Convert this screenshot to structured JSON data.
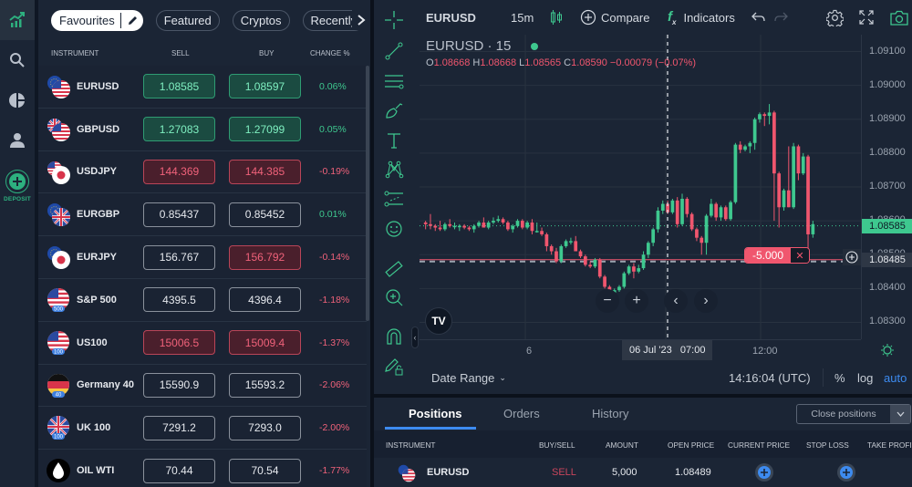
{
  "leftnav": {
    "items": [
      {
        "name": "markets",
        "icon": "chart-trend-icon",
        "active": true
      },
      {
        "name": "search",
        "icon": "search-icon"
      },
      {
        "name": "portfolio",
        "icon": "pie-chart-icon"
      },
      {
        "name": "account",
        "icon": "user-icon"
      }
    ],
    "deposit_label": "DEPOSIT"
  },
  "watchlist": {
    "tabs": [
      {
        "label": "Favourites",
        "active": true
      },
      {
        "label": "Featured"
      },
      {
        "label": "Cryptos"
      },
      {
        "label": "Recently"
      }
    ],
    "columns": {
      "instrument": "INSTRUMENT",
      "sell": "SELL",
      "buy": "BUY",
      "change": "CHANGE %"
    },
    "rows": [
      {
        "name": "EURUSD",
        "sell": "1.08585",
        "buy": "1.08597",
        "change": "0.06%",
        "sell_state": "up",
        "buy_state": "up",
        "dir": "pos",
        "flag": "eu-us"
      },
      {
        "name": "GBPUSD",
        "sell": "1.27083",
        "buy": "1.27099",
        "change": "0.05%",
        "sell_state": "up",
        "buy_state": "up",
        "dir": "pos",
        "flag": "gb-us"
      },
      {
        "name": "USDJPY",
        "sell": "144.369",
        "buy": "144.385",
        "change": "-0.19%",
        "sell_state": "down",
        "buy_state": "down",
        "dir": "neg",
        "flag": "us-jp"
      },
      {
        "name": "EURGBP",
        "sell": "0.85437",
        "buy": "0.85452",
        "change": "0.01%",
        "sell_state": "flat",
        "buy_state": "flat",
        "dir": "pos",
        "flag": "eu-gb"
      },
      {
        "name": "EURJPY",
        "sell": "156.767",
        "buy": "156.792",
        "change": "-0.14%",
        "sell_state": "flat",
        "buy_state": "down",
        "dir": "neg",
        "flag": "eu-jp"
      },
      {
        "name": "S&P 500",
        "sell": "4395.5",
        "buy": "4396.4",
        "change": "-1.18%",
        "sell_state": "flat",
        "buy_state": "flat",
        "dir": "neg",
        "flag": "us-500",
        "badge": "500"
      },
      {
        "name": "US100",
        "sell": "15006.5",
        "buy": "15009.4",
        "change": "-1.37%",
        "sell_state": "down",
        "buy_state": "down",
        "dir": "neg",
        "flag": "us-100",
        "badge": "100"
      },
      {
        "name": "Germany 40",
        "sell": "15590.9",
        "buy": "15593.2",
        "change": "-2.06%",
        "sell_state": "flat",
        "buy_state": "flat",
        "dir": "neg",
        "flag": "de-40",
        "badge": "40"
      },
      {
        "name": "UK 100",
        "sell": "7291.2",
        "buy": "7293.0",
        "change": "-2.00%",
        "sell_state": "flat",
        "buy_state": "flat",
        "dir": "neg",
        "flag": "gb-100",
        "badge": "100"
      },
      {
        "name": "OIL WTI",
        "sell": "70.44",
        "buy": "70.54",
        "change": "-1.77%",
        "sell_state": "flat",
        "buy_state": "flat",
        "dir": "neg",
        "flag": "oil"
      }
    ]
  },
  "chart": {
    "symbol": "EURUSD",
    "interval": "15m",
    "compare_label": "Compare",
    "indicators_label": "Indicators",
    "legend_title": "EURUSD · 15",
    "ohlc": {
      "o_label": "O",
      "o": "1.08668",
      "h_label": "H",
      "h": "1.08668",
      "l_label": "L",
      "l": "1.08565",
      "c_label": "C",
      "c": "1.08590",
      "change": "−0.00079 (−0.07%)"
    },
    "y_labels": [
      "1.09100",
      "1.09000",
      "1.08900",
      "1.08800",
      "1.08700",
      "1.08600",
      "1.08500",
      "1.08400",
      "1.08300"
    ],
    "current_price": "1.08585",
    "position_price": "1.08485",
    "position_label": "-5.000",
    "x_labels": [
      "6",
      "12:00"
    ],
    "crosshair_time": "06 Jul '23   07:00",
    "date_range_label": "Date Range",
    "clock": "14:16:04 (UTC)",
    "scale_opts": {
      "pct": "%",
      "log": "log",
      "auto": "auto"
    },
    "colors": {
      "up": "#3ec88f",
      "down": "#f0566e",
      "bg": "#1b2535"
    }
  },
  "chart_data": {
    "type": "candlestick",
    "title": "EURUSD · 15",
    "ylim": [
      1.0825,
      1.0915
    ],
    "candles": [
      [
        1.08595,
        1.086,
        1.08575,
        1.0859
      ],
      [
        1.0859,
        1.0862,
        1.08575,
        1.08585
      ],
      [
        1.08585,
        1.0859,
        1.0857,
        1.0858
      ],
      [
        1.0858,
        1.086,
        1.0857,
        1.08575
      ],
      [
        1.08575,
        1.08595,
        1.0857,
        1.0859
      ],
      [
        1.0859,
        1.08605,
        1.0858,
        1.08585
      ],
      [
        1.08585,
        1.08595,
        1.08575,
        1.08585
      ],
      [
        1.08585,
        1.0859,
        1.0857,
        1.08585
      ],
      [
        1.08585,
        1.0859,
        1.08575,
        1.0858
      ],
      [
        1.0858,
        1.08585,
        1.0857,
        1.08575
      ],
      [
        1.08575,
        1.0859,
        1.08565,
        1.08585
      ],
      [
        1.08585,
        1.086,
        1.0858,
        1.08595
      ],
      [
        1.08595,
        1.0861,
        1.08585,
        1.0858
      ],
      [
        1.0858,
        1.086,
        1.08575,
        1.08595
      ],
      [
        1.08595,
        1.0861,
        1.0859,
        1.086
      ],
      [
        1.086,
        1.08615,
        1.08595,
        1.08605
      ],
      [
        1.08605,
        1.0861,
        1.0859,
        1.08595
      ],
      [
        1.08595,
        1.086,
        1.0857,
        1.08575
      ],
      [
        1.08575,
        1.0859,
        1.08565,
        1.08585
      ],
      [
        1.08585,
        1.08605,
        1.0858,
        1.086
      ],
      [
        1.086,
        1.08605,
        1.08575,
        1.0858
      ],
      [
        1.0858,
        1.086,
        1.08575,
        1.08595
      ],
      [
        1.08595,
        1.08605,
        1.0856,
        1.0857
      ],
      [
        1.0857,
        1.08595,
        1.08565,
        1.0857
      ],
      [
        1.0857,
        1.0858,
        1.08555,
        1.0856
      ],
      [
        1.0856,
        1.08565,
        1.0851,
        1.08525
      ],
      [
        1.08525,
        1.0853,
        1.085,
        1.0851
      ],
      [
        1.0851,
        1.0852,
        1.08475,
        1.0848
      ],
      [
        1.0848,
        1.0853,
        1.08475,
        1.08525
      ],
      [
        1.08525,
        1.08545,
        1.0852,
        1.0854
      ],
      [
        1.0854,
        1.0855,
        1.0853,
        1.0854
      ],
      [
        1.0854,
        1.08555,
        1.0851,
        1.0851
      ],
      [
        1.0851,
        1.08515,
        1.0849,
        1.08495
      ],
      [
        1.08495,
        1.085,
        1.08465,
        1.0847
      ],
      [
        1.0847,
        1.0848,
        1.0846,
        1.08465
      ],
      [
        1.08465,
        1.0849,
        1.0846,
        1.08485
      ],
      [
        1.08485,
        1.0849,
        1.0843,
        1.08435
      ],
      [
        1.08435,
        1.0844,
        1.084,
        1.08405
      ],
      [
        1.08405,
        1.0841,
        1.0838,
        1.08385
      ],
      [
        1.08385,
        1.084,
        1.0837,
        1.08395
      ],
      [
        1.08395,
        1.0841,
        1.0839,
        1.08405
      ],
      [
        1.08405,
        1.0845,
        1.084,
        1.08445
      ],
      [
        1.08445,
        1.0847,
        1.0844,
        1.08465
      ],
      [
        1.08465,
        1.08475,
        1.0843,
        1.0845
      ],
      [
        1.0845,
        1.0847,
        1.08445,
        1.0846
      ],
      [
        1.0846,
        1.0851,
        1.08455,
        1.085
      ],
      [
        1.085,
        1.0854,
        1.0849,
        1.08535
      ],
      [
        1.08535,
        1.0858,
        1.08525,
        1.08575
      ],
      [
        1.08575,
        1.0864,
        1.08565,
        1.0863
      ],
      [
        1.0863,
        1.0866,
        1.0862,
        1.0865
      ],
      [
        1.0865,
        1.0866,
        1.0862,
        1.08625
      ],
      [
        1.08625,
        1.08665,
        1.0862,
        1.0866
      ],
      [
        1.0866,
        1.0867,
        1.0858,
        1.0859
      ],
      [
        1.0859,
        1.0868,
        1.08585,
        1.08665
      ],
      [
        1.08665,
        1.0867,
        1.0861,
        1.0862
      ],
      [
        1.0862,
        1.08625,
        1.0857,
        1.08575
      ],
      [
        1.08575,
        1.0858,
        1.0854,
        1.0855
      ],
      [
        1.0855,
        1.08555,
        1.085,
        1.08535
      ],
      [
        1.08535,
        1.0862,
        1.085,
        1.08615
      ],
      [
        1.08615,
        1.08665,
        1.0861,
        1.0865
      ],
      [
        1.0865,
        1.08655,
        1.086,
        1.0861
      ],
      [
        1.0861,
        1.08645,
        1.086,
        1.0864
      ],
      [
        1.0864,
        1.08645,
        1.086,
        1.08605
      ],
      [
        1.08605,
        1.0866,
        1.086,
        1.08655
      ],
      [
        1.08655,
        1.0883,
        1.0865,
        1.08825
      ],
      [
        1.08825,
        1.08835,
        1.088,
        1.0881
      ],
      [
        1.0881,
        1.08825,
        1.08805,
        1.0882
      ],
      [
        1.0882,
        1.08835,
        1.088,
        1.0883
      ],
      [
        1.0883,
        1.08905,
        1.0881,
        1.089
      ],
      [
        1.089,
        1.0892,
        1.0889,
        1.08915
      ],
      [
        1.08915,
        1.0892,
        1.0888,
        1.0891
      ],
      [
        1.0891,
        1.08945,
        1.08885,
        1.0892
      ],
      [
        1.0892,
        1.08925,
        1.086,
        1.0874
      ],
      [
        1.0874,
        1.08745,
        1.0858,
        1.0864
      ],
      [
        1.0864,
        1.08695,
        1.0863,
        1.0869
      ],
      [
        1.0869,
        1.0882,
        1.0864,
        1.0864
      ],
      [
        1.0864,
        1.0883,
        1.08635,
        1.0882
      ],
      [
        1.0882,
        1.08825,
        1.0872,
        1.0874
      ],
      [
        1.0874,
        1.088,
        1.08735,
        1.0879
      ],
      [
        1.0879,
        1.08795,
        1.0848,
        1.0856
      ],
      [
        1.0856,
        1.086,
        1.0855,
        1.0859
      ]
    ]
  },
  "positions": {
    "tabs": [
      {
        "label": "Positions",
        "active": true
      },
      {
        "label": "Orders"
      },
      {
        "label": "History"
      }
    ],
    "close_label": "Close positions",
    "columns": [
      "INSTRUMENT",
      "BUY/SELL",
      "AMOUNT",
      "OPEN PRICE",
      "CURRENT PRICE",
      "STOP LOSS",
      "TAKE PROFIT"
    ],
    "rows": [
      {
        "instrument": "EURUSD",
        "side": "SELL",
        "amount": "5,000",
        "open_price": "1.08489"
      }
    ]
  }
}
